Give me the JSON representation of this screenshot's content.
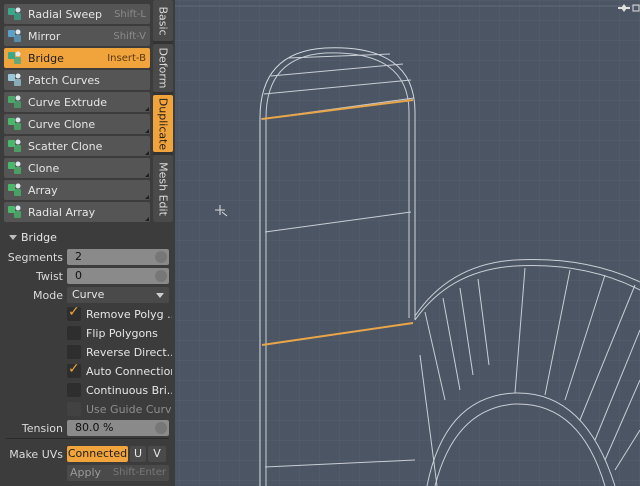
{
  "tools": [
    {
      "label": "Radial Sweep",
      "shortcut": "Shift-L",
      "icon": "radial-sweep-icon",
      "active": false,
      "corner": false
    },
    {
      "label": "Mirror",
      "shortcut": "Shift-V",
      "icon": "mirror-icon",
      "active": false,
      "corner": false
    },
    {
      "label": "Bridge",
      "shortcut": "Insert-B",
      "icon": "bridge-icon",
      "active": true,
      "corner": false
    },
    {
      "label": "Patch Curves",
      "shortcut": "",
      "icon": "patch-curves-icon",
      "active": false,
      "corner": false
    },
    {
      "label": "Curve Extrude",
      "shortcut": "",
      "icon": "curve-extrude-icon",
      "active": false,
      "corner": true
    },
    {
      "label": "Curve Clone",
      "shortcut": "",
      "icon": "curve-clone-icon",
      "active": false,
      "corner": true
    },
    {
      "label": "Scatter Clone",
      "shortcut": "",
      "icon": "scatter-clone-icon",
      "active": false,
      "corner": true
    },
    {
      "label": "Clone",
      "shortcut": "",
      "icon": "clone-icon",
      "active": false,
      "corner": true
    },
    {
      "label": "Array",
      "shortcut": "",
      "icon": "array-icon",
      "active": false,
      "corner": true
    },
    {
      "label": "Radial Array",
      "shortcut": "",
      "icon": "radial-array-icon",
      "active": false,
      "corner": true
    }
  ],
  "tabs": [
    "Basic",
    "Deform",
    "Duplicate",
    "Mesh Edit"
  ],
  "active_tab": "Duplicate",
  "props": {
    "title": "Bridge",
    "segments_label": "Segments",
    "segments_value": "2",
    "twist_label": "Twist",
    "twist_value": "0",
    "mode_label": "Mode",
    "mode_value": "Curve",
    "checks": [
      {
        "label": "Remove Polyg ...",
        "checked": true,
        "disabled": false
      },
      {
        "label": "Flip Polygons",
        "checked": false,
        "disabled": false
      },
      {
        "label": "Reverse Direct...",
        "checked": false,
        "disabled": false
      },
      {
        "label": "Auto Connection",
        "checked": true,
        "disabled": false
      },
      {
        "label": "Continuous Bri...",
        "checked": false,
        "disabled": false
      },
      {
        "label": "Use Guide Curve",
        "checked": false,
        "disabled": true
      }
    ],
    "tension_label": "Tension",
    "tension_value": "80.0 %",
    "make_uvs_label": "Make UVs",
    "connected_label": "Connected",
    "u_label": "U",
    "v_label": "V",
    "apply_label": "Apply",
    "apply_shortcut": "Shift-Enter"
  },
  "colors": {
    "accent": "#f2a43c",
    "viewport": "#4b5563",
    "panel": "#3c3c3c",
    "button": "#555555",
    "wire": "#c9ced6",
    "selected_edge": "#e8a54a"
  }
}
